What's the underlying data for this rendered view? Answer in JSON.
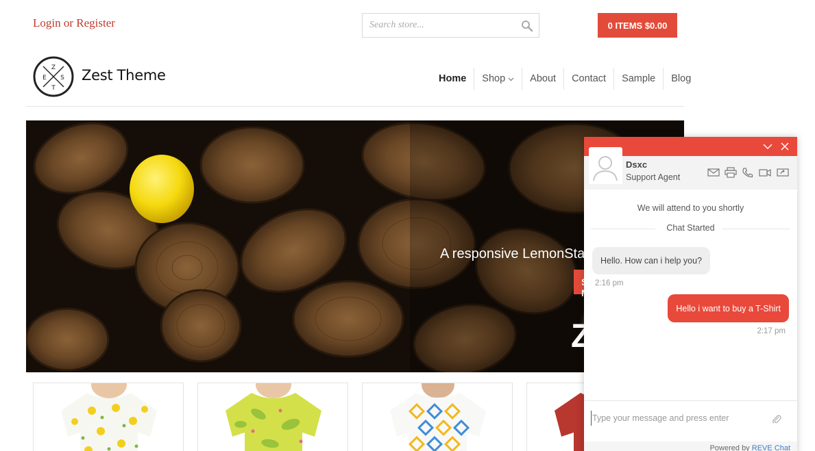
{
  "header": {
    "login_label": "Login or Register",
    "search_placeholder": "Search store...",
    "cart_label": "0 ITEMS $0.00",
    "logo_text": "Zest Theme",
    "logo_letters": {
      "top": "Z",
      "left": "E",
      "right": "S",
      "bottom": "T"
    },
    "nav": [
      {
        "label": "Home",
        "active": true
      },
      {
        "label": "Shop",
        "has_dropdown": true
      },
      {
        "label": "About"
      },
      {
        "label": "Contact"
      },
      {
        "label": "Sample"
      },
      {
        "label": "Blog"
      }
    ]
  },
  "hero": {
    "title": "Zest",
    "subtitle": "A responsive LemonStand theme",
    "button_label": "Shop Now"
  },
  "products": [
    {
      "icon": "lemon-print-tshirt"
    },
    {
      "icon": "green-leaf-print-tshirt"
    },
    {
      "icon": "geometric-print-tshirt"
    },
    {
      "icon": "red-tshirt"
    }
  ],
  "chat": {
    "agent_name": "Dsxc",
    "agent_role": "Support Agent",
    "notice": "We will attend to you shortly",
    "started_label": "Chat Started",
    "messages": [
      {
        "from": "agent",
        "text": "Hello. How can i help you?",
        "time": "2:16 pm"
      },
      {
        "from": "user",
        "text": "Hello i want to buy a T-Shirt",
        "time": "2:17 pm"
      }
    ],
    "input_placeholder": "Type your message and press enter",
    "powered_by": "Powered by",
    "brand": "REVE Chat"
  },
  "colors": {
    "accent": "#e24b3a",
    "chat_accent": "#e8493b",
    "link": "#c0392b"
  }
}
